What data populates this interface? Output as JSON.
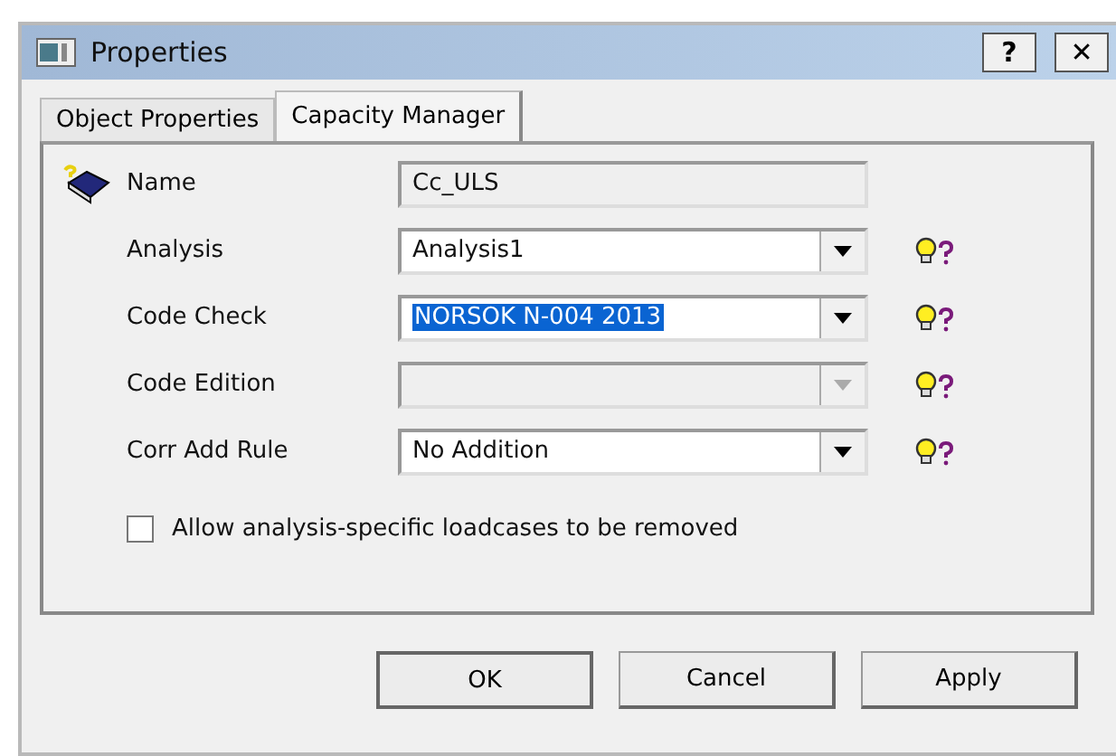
{
  "window": {
    "title": "Properties",
    "help_button": "?",
    "close_button": "✕"
  },
  "tabs": [
    {
      "label": "Object Properties",
      "selected": false
    },
    {
      "label": "Capacity Manager",
      "selected": true
    }
  ],
  "fields": [
    {
      "kind": "text",
      "label": "Name",
      "value": "Cc_ULS",
      "disabled": true,
      "highlighted": false,
      "help": false
    },
    {
      "kind": "dropdown",
      "label": "Analysis",
      "value": "Analysis1",
      "disabled": false,
      "highlighted": false,
      "help": true
    },
    {
      "kind": "dropdown",
      "label": "Code Check",
      "value": "NORSOK N-004 2013",
      "disabled": false,
      "highlighted": true,
      "help": true
    },
    {
      "kind": "dropdown",
      "label": "Code Edition",
      "disabled": true,
      "highlighted": false,
      "help": true
    },
    {
      "kind": "dropdown",
      "label": "Corr Add Rule",
      "value": "No Addition",
      "disabled": false,
      "highlighted": false,
      "help": true
    }
  ],
  "checkbox": {
    "label": "Allow analysis-specific loadcases to be removed",
    "checked": false
  },
  "buttons": [
    {
      "label": "OK",
      "default": true
    },
    {
      "label": "Cancel",
      "default": false
    },
    {
      "label": "Apply",
      "default": false
    }
  ]
}
